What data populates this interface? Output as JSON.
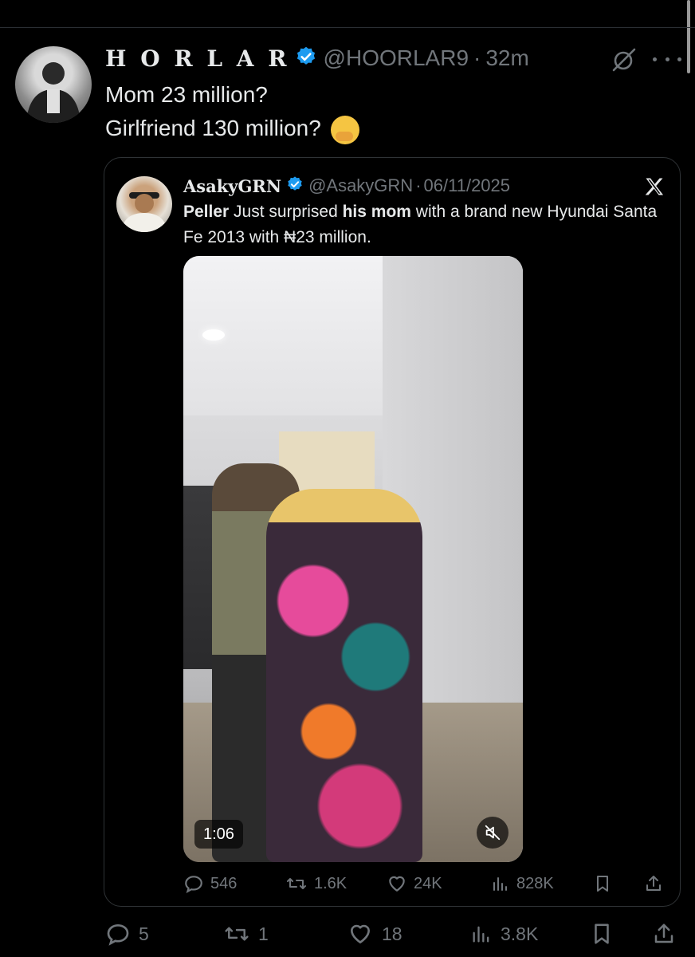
{
  "post": {
    "display_name": "H O R L A R",
    "handle": "@HOORLAR9",
    "separator": "·",
    "time": "32m",
    "text_line1": "Mom 23 million?",
    "text_line2": "Girlfriend 130 million?",
    "emoji": "face-with-hand-over-mouth"
  },
  "quote": {
    "display_name": "AsakyGRN",
    "handle": "@AsakyGRN",
    "separator": "·",
    "date": "06/11/2025",
    "text": {
      "bold1": "Peller",
      "part1": " Just surprised ",
      "bold2": "his mom",
      "part2": " with a brand new Hyundai Santa Fe 2013 with ₦23 million."
    },
    "video_duration": "1:06",
    "stats": {
      "replies": "546",
      "reposts": "1.6K",
      "likes": "24K",
      "views": "828K"
    }
  },
  "stats": {
    "replies": "5",
    "reposts": "1",
    "likes": "18",
    "views": "3.8K"
  },
  "colors": {
    "background": "#000000",
    "text": "#e7e9ea",
    "muted": "#71767b",
    "verified": "#1d9bf0",
    "border": "#2f3336"
  }
}
